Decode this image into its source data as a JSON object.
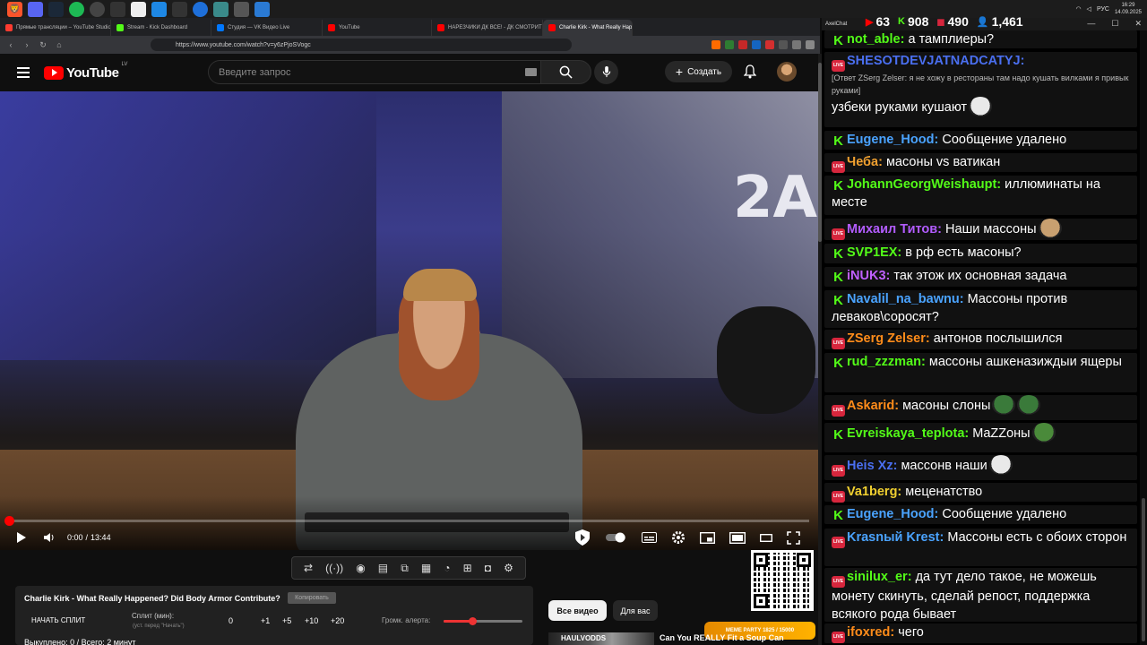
{
  "taskbar": {
    "clock_time": "16:29",
    "clock_date": "14.09.2025",
    "lang": "РУС"
  },
  "browser": {
    "tabs": [
      {
        "label": "Прямые трансляции – YouTube Studio",
        "color": "#ff3b30"
      },
      {
        "label": "Stream - Kick Dashboard",
        "color": "#53fc18"
      },
      {
        "label": "Студия — VK Видео Live",
        "color": "#0077ff"
      },
      {
        "label": "YouTube",
        "color": "#ff0000"
      },
      {
        "label": "НАРЕЗЧИКИ ДК ВСЕ! - ДК СМОТРИТ",
        "color": "#ff0000"
      },
      {
        "label": "Charlie Kirk - What Really Happened",
        "color": "#ff0000"
      }
    ],
    "url": "https://www.youtube.com/watch?v=y6zPjoSVogc"
  },
  "youtube": {
    "logo_text": "YouTube",
    "logo_region": "LV",
    "search_placeholder": "Введите запрос",
    "create_label": "Создать"
  },
  "player": {
    "current_time": "0:00",
    "duration": "13:44",
    "progress_fraction": 0.0
  },
  "split_panel": {
    "video_title": "Charlie Kirk - What Really Happened? Did Body Armor Contribute?",
    "copy_label": "Копировать",
    "start_split_label": "НАЧАТЬ СПЛИТ",
    "split_min_label": "Сплит (мин):",
    "split_hint": "(уст. перед \"Начать\")",
    "split_value": "0",
    "increments": [
      "+1",
      "+5",
      "+10",
      "+20"
    ],
    "alert_volume_label": "Громк. алерта:",
    "alert_volume_fraction": 0.36,
    "stats": "Выкуплено: 0 / Всего: 2 минут"
  },
  "chips": {
    "all_videos": "Все видео",
    "for_you": "Для вас"
  },
  "recommended": {
    "title": "Can You REALLY Fit a Soup Can",
    "thumb_text": "HAULVODDS"
  },
  "overlay": {
    "meme_party_label": "MEME PARTY",
    "meme_party_sub": "1825 / 15000"
  },
  "chat_window": {
    "app_name": "AxelChat",
    "stats": [
      {
        "icon": "youtube-icon",
        "value": "63",
        "color": "#ff0000"
      },
      {
        "icon": "kick-icon",
        "value": "908",
        "color": "#53fc18"
      },
      {
        "icon": "vk-live-icon",
        "value": "490",
        "color": "#d7263d"
      },
      {
        "icon": "viewers-icon",
        "value": "1,461",
        "color": "#4aa3ff"
      }
    ]
  },
  "chat": [
    {
      "platform": "kick",
      "nick": "not_able:",
      "color": "#53fc18",
      "text": "а тамплиеры?"
    },
    {
      "platform": "vk",
      "nick": "SHESOTDEVJATNADCATYJ:",
      "color": "#4a6ff0",
      "reply": "[Ответ ZSerg Zelser: я не хожу в рестораны там надо кушать вилками я привык руками]",
      "text": "узбеки руками кушают",
      "emote": "#e9e9e9"
    },
    {
      "platform": "kick",
      "nick": "Eugene_Hood:",
      "color": "#4aa3ff",
      "text": "Сообщение удалено"
    },
    {
      "platform": "vk",
      "nick": "Чеба:",
      "color": "#f0a030",
      "text": "масоны vs ватикан"
    },
    {
      "platform": "kick",
      "nick": "JohannGeorgWeishaupt:",
      "color": "#53fc18",
      "text": "иллюминаты на месте"
    },
    {
      "platform": "vk",
      "nick": "Михаил Титов:",
      "color": "#b25cff",
      "text": "Наши массоны",
      "emote": "#c8a070"
    },
    {
      "platform": "kick",
      "nick": "SVP1EX:",
      "color": "#53fc18",
      "text": "в рф есть масоны?"
    },
    {
      "platform": "kick",
      "nick": "iNUK3:",
      "color": "#c060ff",
      "text": "так этож их основная задача"
    },
    {
      "platform": "kick",
      "nick": "Navalil_na_bawnu:",
      "color": "#4aa3ff",
      "text": "Массоны против леваков\\соросят?"
    },
    {
      "platform": "vk",
      "nick": "ZSerg Zelser:",
      "color": "#ff8c1a",
      "text": "антонов послышился"
    },
    {
      "platform": "kick",
      "nick": "rud_zzzman:",
      "color": "#53fc18",
      "text": "массоны ашкеназиждыи ящеры"
    },
    {
      "platform": "vk",
      "nick": "Askarid:",
      "color": "#ff8c1a",
      "text": "масоны слоны",
      "emote": "#3a7a3a",
      "emote2": "#3a7a3a"
    },
    {
      "platform": "kick",
      "nick": "Evreiskaya_teplota:",
      "color": "#53fc18",
      "text": "MaZZоны",
      "emote": "#4a8a3a"
    },
    {
      "platform": "vk",
      "nick": "Heis Xz:",
      "color": "#4a6ff0",
      "text": "массонв наши",
      "emote": "#e9e9e9"
    },
    {
      "platform": "vk",
      "nick": "Va1berg:",
      "color": "#f0d030",
      "text": "меценатство"
    },
    {
      "platform": "kick",
      "nick": "Eugene_Hood:",
      "color": "#4aa3ff",
      "text": "Сообщение удалено"
    },
    {
      "platform": "vk",
      "nick": "Krasnый Krest:",
      "color": "#4aa3ff",
      "text": "Массоны есть с обоих сторон"
    },
    {
      "platform": "vk",
      "nick": "sinilux_er:",
      "color": "#53fc18",
      "text": "да тут дело такое, не можешь монету скинуть, сделай репост, поддержка всякого рода бывает"
    },
    {
      "platform": "vk",
      "nick": "ifoxred:",
      "color": "#ff8c1a",
      "text": "чего"
    }
  ]
}
